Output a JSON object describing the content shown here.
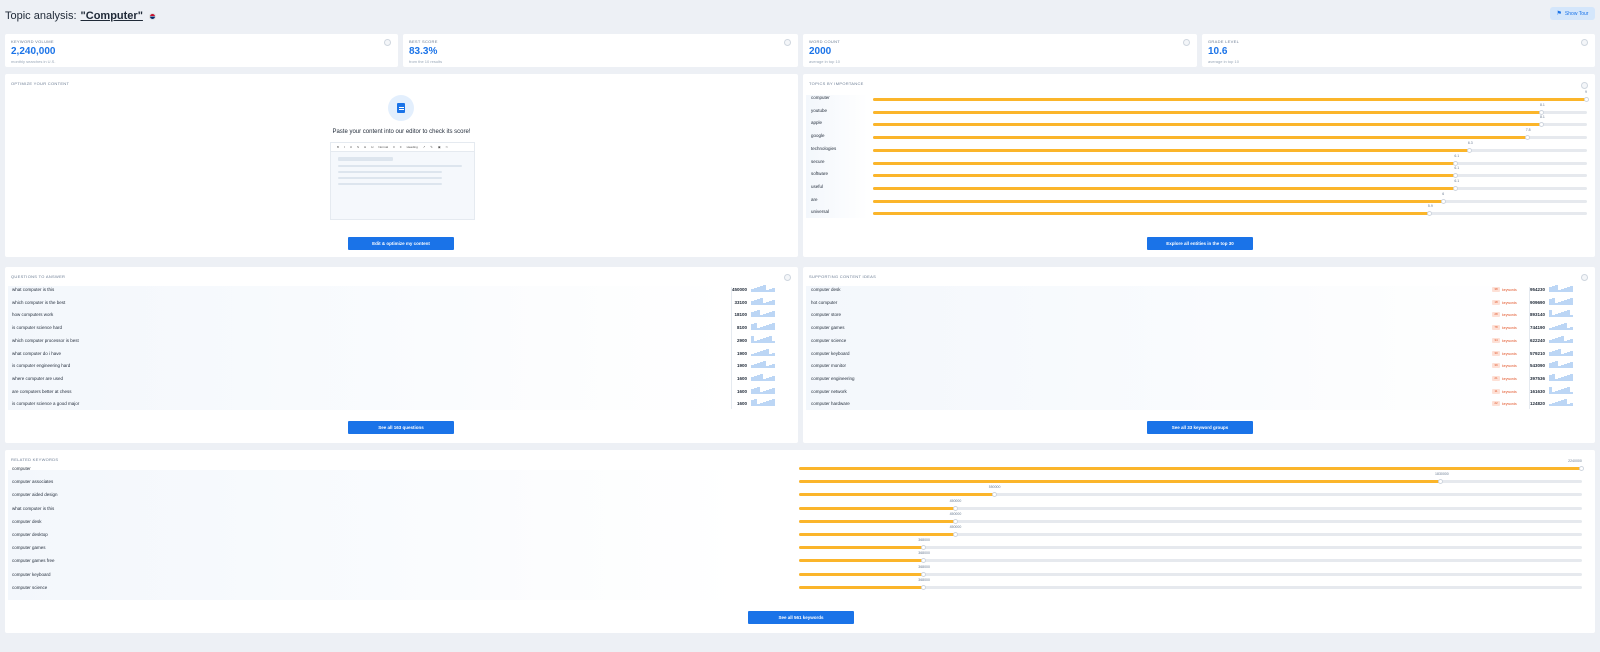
{
  "header": {
    "title_prefix": "Topic analysis:",
    "topic": "\"Computer\"",
    "flag_icon": "us-flag-icon",
    "show_tour_label": "Show Tour"
  },
  "stats": [
    {
      "label": "KEYWORD VOLUME",
      "value": "2,240,000",
      "sub": "monthly searches in U.S."
    },
    {
      "label": "BEST SCORE",
      "value": "83.3%",
      "sub": "from the 10 results"
    },
    {
      "label": "WORD COUNT",
      "value": "2000",
      "sub": "average in top 10"
    },
    {
      "label": "GRADE LEVEL",
      "value": "10.6",
      "sub": "average in top 10"
    }
  ],
  "optimize": {
    "title": "OPTIMIZE YOUR CONTENT",
    "paste_text": "Paste your content into our editor to check its score!",
    "toolbar": [
      "B",
      "I",
      "U",
      "S",
      "H",
      "H",
      "Normal",
      "≡",
      "≡",
      "Heading",
      "↗",
      "✎",
      "▣",
      "✂"
    ],
    "button": "Edit & optimize my content"
  },
  "topics": {
    "title": "TOPICS BY IMPORTANCE",
    "button": "Explore all entities in the top 30",
    "items": [
      {
        "label": "computer",
        "value": "9",
        "frac": 1.0
      },
      {
        "label": "youtube",
        "value": "8.1",
        "frac": 0.937
      },
      {
        "label": "apple",
        "value": "8.1",
        "frac": 0.937
      },
      {
        "label": "google",
        "value": "7.8",
        "frac": 0.917
      },
      {
        "label": "technologies",
        "value": "6.3",
        "frac": 0.836
      },
      {
        "label": "secure",
        "value": "6.1",
        "frac": 0.817
      },
      {
        "label": "software",
        "value": "6.1",
        "frac": 0.817
      },
      {
        "label": "useful",
        "value": "6.1",
        "frac": 0.817
      },
      {
        "label": "are",
        "value": "6",
        "frac": 0.8
      },
      {
        "label": "universal",
        "value": "5.9",
        "frac": 0.78
      }
    ]
  },
  "questions": {
    "title": "QUESTIONS TO ANSWER",
    "button": "See all 163 questions",
    "items": [
      {
        "q": "what computer is this",
        "n": "450000"
      },
      {
        "q": "which computer is the best",
        "n": "33100"
      },
      {
        "q": "how computers work",
        "n": "18100"
      },
      {
        "q": "is computer science hard",
        "n": "8100"
      },
      {
        "q": "which computer processor is best",
        "n": "2900"
      },
      {
        "q": "what computer do i have",
        "n": "1900"
      },
      {
        "q": "is computer engineering hard",
        "n": "1900"
      },
      {
        "q": "where computer are used",
        "n": "1600"
      },
      {
        "q": "are computers better at chess",
        "n": "1600"
      },
      {
        "q": "is computer science a good major",
        "n": "1600"
      }
    ]
  },
  "supporting": {
    "title": "SUPPORTING CONTENT IDEAS",
    "button": "See all 33 keyword groups",
    "keywords_word": "keywords",
    "items": [
      {
        "label": "computer desk",
        "count": "38",
        "n": "954230"
      },
      {
        "label": "hot computer",
        "count": "18",
        "n": "909690"
      },
      {
        "label": "computer store",
        "count": "28",
        "n": "893140"
      },
      {
        "label": "computer games",
        "count": "78",
        "n": "744190"
      },
      {
        "label": "computer science",
        "count": "34",
        "n": "622240"
      },
      {
        "label": "computer keyboard",
        "count": "30",
        "n": "579210"
      },
      {
        "label": "computer monitor",
        "count": "39",
        "n": "543090"
      },
      {
        "label": "computer engineering",
        "count": "21",
        "n": "397536"
      },
      {
        "label": "computer network",
        "count": "11",
        "n": "161630"
      },
      {
        "label": "computer hardware",
        "count": "22",
        "n": "124820"
      }
    ]
  },
  "related": {
    "title": "RELATED KEYWORDS",
    "button": "See all 561 keywords",
    "items": [
      {
        "label": "computer",
        "value": "2240000",
        "frac": 1.0
      },
      {
        "label": "computer associates",
        "value": "1830000",
        "frac": 0.82
      },
      {
        "label": "computer aided design",
        "value": "550000",
        "frac": 0.25
      },
      {
        "label": "what computer is this",
        "value": "450000",
        "frac": 0.2
      },
      {
        "label": "computer desk",
        "value": "450000",
        "frac": 0.2
      },
      {
        "label": "computer desktop",
        "value": "450000",
        "frac": 0.2
      },
      {
        "label": "computer games",
        "value": "368000",
        "frac": 0.16
      },
      {
        "label": "computer games free",
        "value": "368000",
        "frac": 0.16
      },
      {
        "label": "computer keyboard",
        "value": "368000",
        "frac": 0.16
      },
      {
        "label": "computer science",
        "value": "368000",
        "frac": 0.16
      }
    ]
  }
}
